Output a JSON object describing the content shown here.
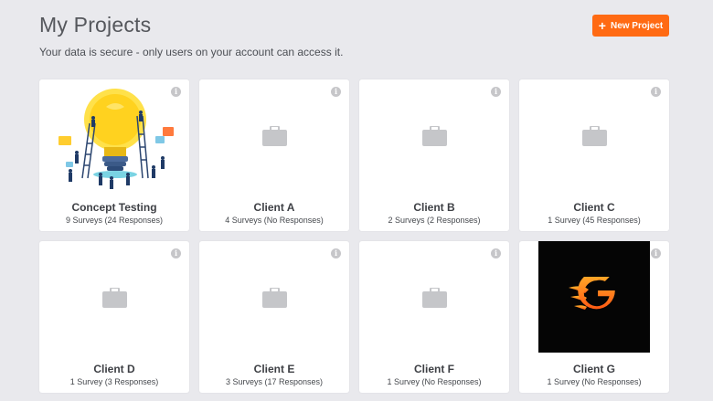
{
  "header": {
    "title": "My Projects",
    "subtitle": "Your data is secure - only users on your account can access it.",
    "new_project_label": "New Project",
    "new_project_icon": "+"
  },
  "colors": {
    "accent": "#ff6a13",
    "background": "#e9e9ed",
    "card": "#ffffff",
    "icon_gray": "#c6c6c9"
  },
  "info_glyph": "i",
  "projects": [
    {
      "name": "Concept Testing",
      "meta": "9 Surveys (24 Responses)",
      "thumbnail": "lightbulb-illustration"
    },
    {
      "name": "Client A",
      "meta": "4 Surveys (No Responses)",
      "thumbnail": "briefcase-icon"
    },
    {
      "name": "Client B",
      "meta": "2 Surveys (2 Responses)",
      "thumbnail": "briefcase-icon"
    },
    {
      "name": "Client C",
      "meta": "1 Survey (45 Responses)",
      "thumbnail": "briefcase-icon"
    },
    {
      "name": "Client D",
      "meta": "1 Survey (3 Responses)",
      "thumbnail": "briefcase-icon"
    },
    {
      "name": "Client E",
      "meta": "3 Surveys (17 Responses)",
      "thumbnail": "briefcase-icon"
    },
    {
      "name": "Client F",
      "meta": "1 Survey (No Responses)",
      "thumbnail": "briefcase-icon"
    },
    {
      "name": "Client G",
      "meta": "1 Survey (No Responses)",
      "thumbnail": "g-flame-logo"
    }
  ]
}
